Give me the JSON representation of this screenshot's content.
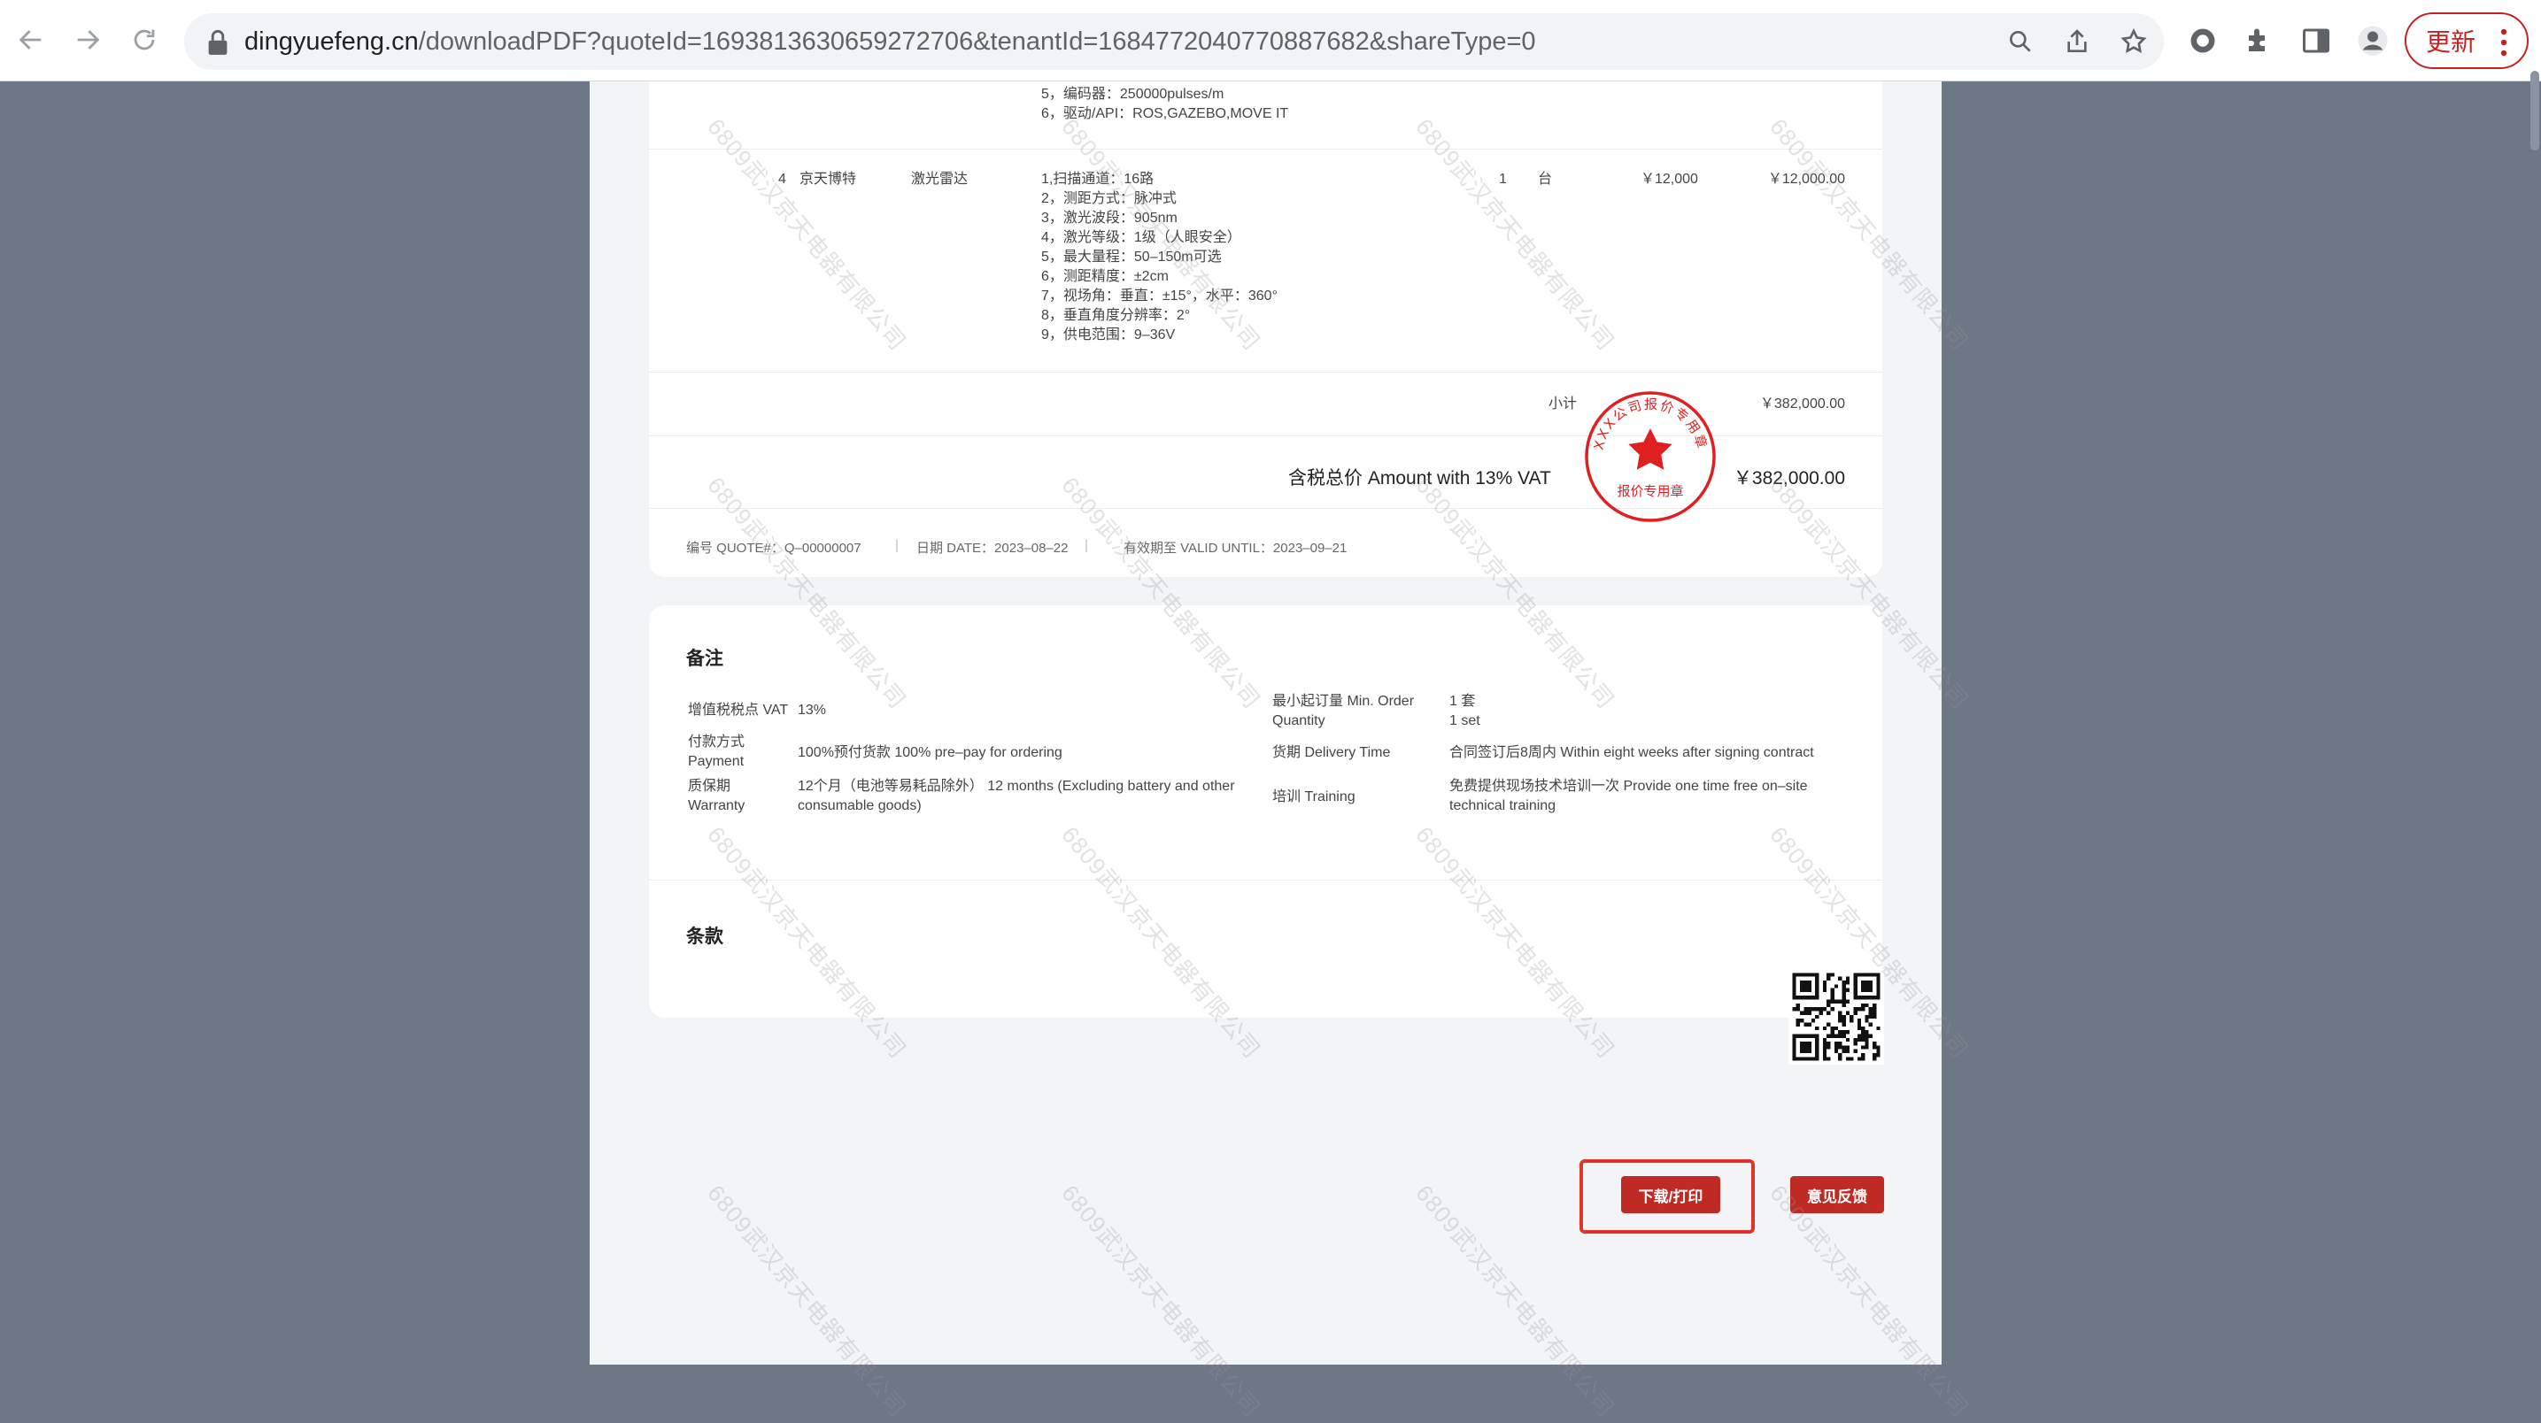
{
  "browser": {
    "url_host": "dingyuefeng.cn",
    "url_rest": "/downloadPDF?quoteId=1693813630659272706&tenantId=1684772040770887682&shareType=0",
    "update_label": "更新"
  },
  "quote": {
    "prev_item_specs": [
      "5，编码器：250000pulses/m",
      "6，驱动/API：ROS,GAZEBO,MOVE IT"
    ],
    "item": {
      "no": "4",
      "brand": "京天博特",
      "name": "激光雷达",
      "specs": [
        "1,扫描通道：16路",
        "2，测距方式：脉冲式",
        "3，激光波段：905nm",
        "4，激光等级：1级（人眼安全）",
        "5，最大量程：50–150m可选",
        "6，测距精度：±2cm",
        "7，视场角：垂直：±15°，水平：360°",
        "8，垂直角度分辨率：2°",
        "9，供电范围：9–36V"
      ],
      "qty": "1",
      "unit": "台",
      "unit_price": "￥12,000",
      "amount": "￥12,000.00"
    },
    "subtotal_label": "小计",
    "subtotal_value": "￥382,000.00",
    "total_label": "含税总价 Amount with 13% VAT",
    "total_value": "￥382,000.00",
    "quote_no": "编号 QUOTE#：Q–00000007",
    "date": "日期 DATE：2023–08–22",
    "valid_until": "有效期至 VALID UNTIL：2023–09–21"
  },
  "seal": {
    "outer_text": "XXX公司报价专用章",
    "inner_text": "报价专用章",
    "color": "#e02020"
  },
  "notes": {
    "title": "备注",
    "vat_label": "增值税税点 VAT",
    "vat_value": "13%",
    "payment_label_cn": "付款方式",
    "payment_label_en": "Payment",
    "payment_value": "100%预付货款 100% pre–pay for ordering",
    "warranty_label_cn": "质保期",
    "warranty_label_en": "Warranty",
    "warranty_value_1": "12个月（电池等易耗品除外） 12 months (Excluding battery and other",
    "warranty_value_2": "consumable goods)",
    "moq_label_1": "最小起订量 Min. Order",
    "moq_label_2": "Quantity",
    "moq_value_1": "1 套",
    "moq_value_2": "1 set",
    "delivery_label": "货期 Delivery Time",
    "delivery_value": "合同签订后8周内 Within eight weeks after signing contract",
    "training_label": "培训 Training",
    "training_value_1": "免费提供现场技术培训一次 Provide one time free on–site",
    "training_value_2": "technical training"
  },
  "terms": {
    "title": "条款"
  },
  "watermark": "6809武汉京天电器有限公司",
  "actions": {
    "download_label": "下载/打印",
    "feedback_label": "意见反馈"
  },
  "colors": {
    "accent": "#c02a25",
    "page_bg": "#6e7785",
    "seal": "#e02020"
  }
}
